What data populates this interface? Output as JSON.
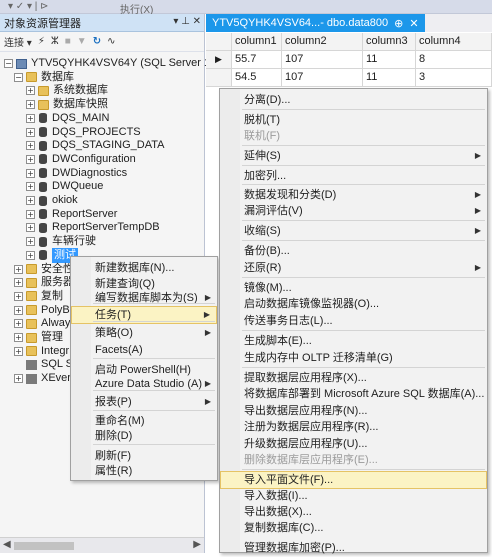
{
  "top_toolbar": {
    "execute_label": "执行(X)"
  },
  "object_explorer": {
    "title": "对象资源管理器",
    "connect_label": "连接",
    "pin": "▾ ⊥ ✕",
    "tree": [
      {
        "label": "YTV5QYHK4VSV64Y (SQL Server 13.0",
        "icon": "server-icon",
        "expander": "⊟"
      },
      {
        "label": "数据库",
        "icon": "folder-icon",
        "expander": "⊟"
      },
      {
        "label": "系统数据库",
        "icon": "folder-icon",
        "expander": "⊞"
      },
      {
        "label": "数据库快照",
        "icon": "folder-icon",
        "expander": "⊞"
      },
      {
        "label": "DQS_MAIN",
        "icon": "database-icon",
        "expander": "⊞"
      },
      {
        "label": "DQS_PROJECTS",
        "icon": "database-icon",
        "expander": "⊞"
      },
      {
        "label": "DQS_STAGING_DATA",
        "icon": "database-icon",
        "expander": "⊞"
      },
      {
        "label": "DWConfiguration",
        "icon": "database-icon",
        "expander": "⊞"
      },
      {
        "label": "DWDiagnostics",
        "icon": "database-icon",
        "expander": "⊞"
      },
      {
        "label": "DWQueue",
        "icon": "database-icon",
        "expander": "⊞"
      },
      {
        "label": "okiok",
        "icon": "database-icon",
        "expander": "⊞"
      },
      {
        "label": "ReportServer",
        "icon": "database-icon",
        "expander": "⊞"
      },
      {
        "label": "ReportServerTempDB",
        "icon": "database-icon",
        "expander": "⊞"
      },
      {
        "label": "车辆行驶",
        "icon": "database-icon",
        "expander": "⊞"
      },
      {
        "label": "测试",
        "icon": "database-icon",
        "expander": "⊞"
      },
      {
        "label": "安全性",
        "icon": "folder-icon",
        "expander": "⊞"
      },
      {
        "label": "服务器",
        "icon": "folder-icon",
        "expander": "⊞"
      },
      {
        "label": "复制",
        "icon": "folder-icon",
        "expander": "⊞"
      },
      {
        "label": "PolyB",
        "icon": "folder-icon",
        "expander": "⊞"
      },
      {
        "label": "Alway",
        "icon": "folder-icon",
        "expander": "⊞"
      },
      {
        "label": "管理",
        "icon": "folder-icon",
        "expander": "⊞"
      },
      {
        "label": "Integr",
        "icon": "folder-icon",
        "expander": "⊞"
      },
      {
        "label": "SQL S",
        "icon": "agent-icon",
        "expander": ""
      },
      {
        "label": "XEver",
        "icon": "xevent-icon",
        "expander": "⊞"
      }
    ]
  },
  "tab": {
    "title": "YTV5QYHK4VSV64...- dbo.data800",
    "pin": "⊕",
    "close": "✕"
  },
  "grid": {
    "columns": [
      "column1",
      "column2",
      "column3",
      "column4"
    ],
    "rows": [
      [
        "55.7",
        "107",
        "11",
        "8"
      ],
      [
        "54.5",
        "107",
        "11",
        "3"
      ]
    ]
  },
  "context_menu_1": {
    "items": [
      {
        "label": "新建数据库(N)...",
        "arrow": ""
      },
      {
        "label": "新建查询(Q)",
        "arrow": ""
      },
      {
        "label": "编写数据库脚本为(S)",
        "arrow": "▶"
      },
      {
        "label": "任务(T)",
        "arrow": "▶"
      },
      {
        "label": "策略(O)",
        "arrow": "▶"
      },
      {
        "label": "Facets(A)",
        "arrow": ""
      },
      {
        "label": "启动 PowerShell(H)",
        "arrow": ""
      },
      {
        "label": "Azure Data Studio (A)",
        "arrow": "▶"
      },
      {
        "label": "报表(P)",
        "arrow": "▶"
      },
      {
        "label": "重命名(M)",
        "arrow": ""
      },
      {
        "label": "删除(D)",
        "arrow": ""
      },
      {
        "label": "刷新(F)",
        "arrow": ""
      },
      {
        "label": "属性(R)",
        "arrow": ""
      }
    ]
  },
  "context_menu_2": {
    "items": [
      {
        "label": "分离(D)...",
        "arrow": ""
      },
      {
        "label": "脱机(T)",
        "arrow": ""
      },
      {
        "label": "联机(F)",
        "arrow": ""
      },
      {
        "label": "延伸(S)",
        "arrow": "▶"
      },
      {
        "label": "加密列...",
        "arrow": ""
      },
      {
        "label": "数据发现和分类(D)",
        "arrow": "▶"
      },
      {
        "label": "漏洞评估(V)",
        "arrow": "▶"
      },
      {
        "label": "收缩(S)",
        "arrow": "▶"
      },
      {
        "label": "备份(B)...",
        "arrow": ""
      },
      {
        "label": "还原(R)",
        "arrow": "▶"
      },
      {
        "label": "镜像(M)...",
        "arrow": ""
      },
      {
        "label": "启动数据库镜像监视器(O)...",
        "arrow": ""
      },
      {
        "label": "传送事务日志(L)...",
        "arrow": ""
      },
      {
        "label": "生成脚本(E)...",
        "arrow": ""
      },
      {
        "label": "生成内存中 OLTP 迁移清单(G)",
        "arrow": ""
      },
      {
        "label": "提取数据层应用程序(X)...",
        "arrow": ""
      },
      {
        "label": "将数据库部署到 Microsoft Azure SQL 数据库(A)...",
        "arrow": ""
      },
      {
        "label": "导出数据层应用程序(N)...",
        "arrow": ""
      },
      {
        "label": "注册为数据层应用程序(R)...",
        "arrow": ""
      },
      {
        "label": "升级数据层应用程序(U)...",
        "arrow": ""
      },
      {
        "label": "删除数据库层应用程序(E)...",
        "arrow": ""
      },
      {
        "label": "导入平面文件(F)...",
        "arrow": ""
      },
      {
        "label": "导入数据(I)...",
        "arrow": ""
      },
      {
        "label": "导出数据(X)...",
        "arrow": ""
      },
      {
        "label": "复制数据库(C)...",
        "arrow": ""
      },
      {
        "label": "管理数据库加密(P)...",
        "arrow": ""
      }
    ]
  }
}
